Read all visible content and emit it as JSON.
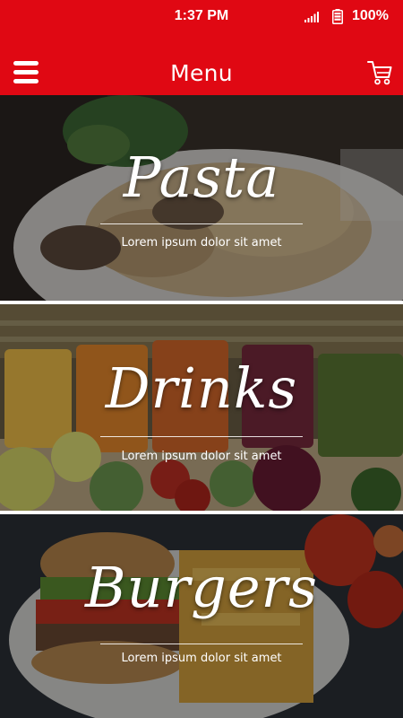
{
  "status_bar": {
    "time": "1:37 PM",
    "battery": "100%",
    "icons": [
      "signal-icon",
      "battery-icon"
    ]
  },
  "app_bar": {
    "title": "Menu",
    "icons": [
      "hamburger-menu-icon",
      "cart-icon"
    ]
  },
  "categories": [
    {
      "title": "Pasta",
      "subtitle": "Lorem ipsum dolor sit amet",
      "photo": "pasta-photo"
    },
    {
      "title": "Drinks",
      "subtitle": "Lorem ipsum dolor sit amet",
      "photo": "drinks-photo"
    },
    {
      "title": "Burgers",
      "subtitle": "Lorem ipsum dolor sit amet",
      "photo": "burger-photo"
    }
  ],
  "colors": {
    "brand_red": "#e00813",
    "text_on_brand": "#ffffff"
  }
}
